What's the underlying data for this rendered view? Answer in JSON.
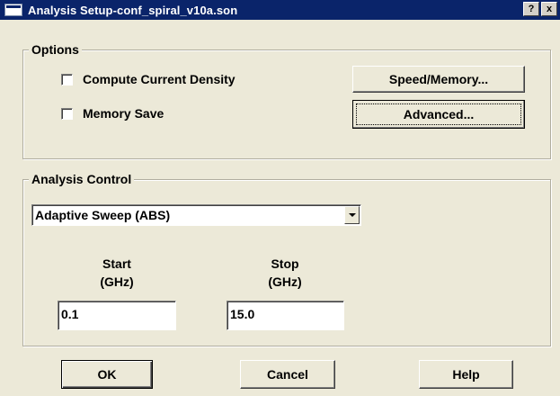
{
  "window": {
    "title": "Analysis Setup-conf_spiral_v10a.son",
    "help_button": "?",
    "close_button": "x"
  },
  "options": {
    "group_label": "Options",
    "compute_current_density": {
      "label": "Compute Current Density",
      "checked": false
    },
    "memory_save": {
      "label": "Memory Save",
      "checked": false
    },
    "speed_memory_button": "Speed/Memory...",
    "advanced_button": "Advanced..."
  },
  "analysis_control": {
    "group_label": "Analysis Control",
    "sweep_type": "Adaptive Sweep (ABS)",
    "start": {
      "label": "Start",
      "unit": "(GHz)",
      "value": "0.1"
    },
    "stop": {
      "label": "Stop",
      "unit": "(GHz)",
      "value": "15.0"
    }
  },
  "buttons": {
    "ok": "OK",
    "cancel": "Cancel",
    "help": "Help"
  }
}
